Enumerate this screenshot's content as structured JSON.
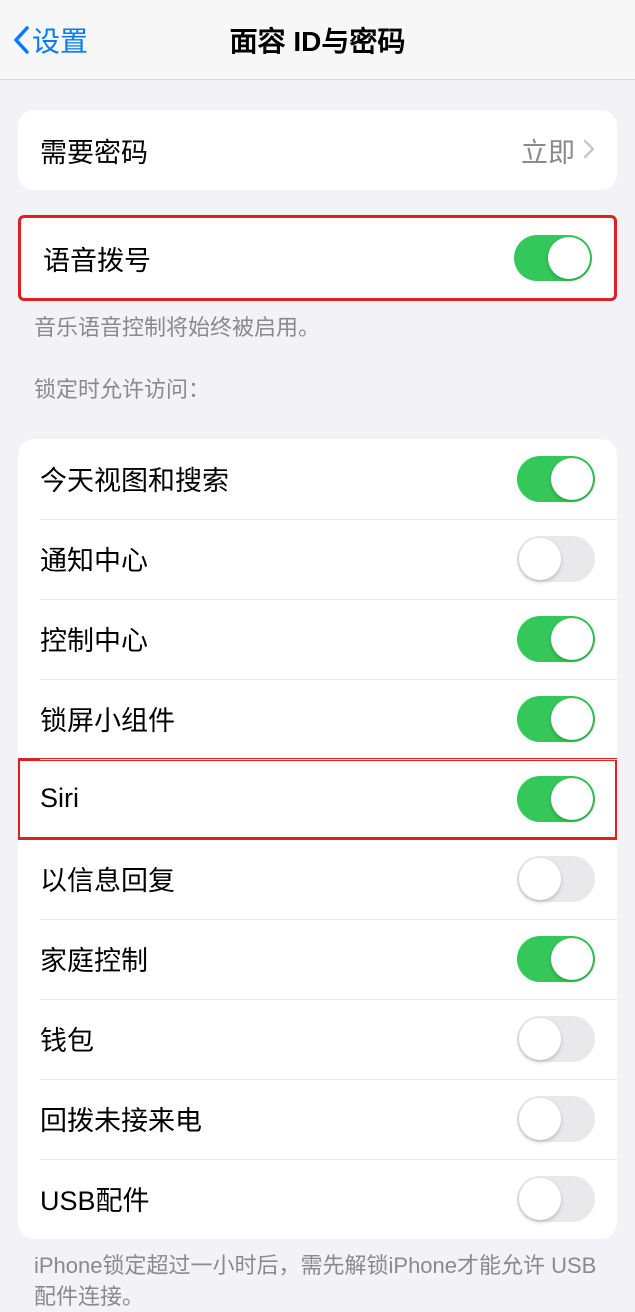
{
  "header": {
    "back_label": "设置",
    "title": "面容 ID与密码"
  },
  "passcode_row": {
    "label": "需要密码",
    "value": "立即"
  },
  "voice_dial": {
    "label": "语音拨号",
    "on": true,
    "footer": "音乐语音控制将始终被启用。"
  },
  "lock_section": {
    "header": "锁定时允许访问：",
    "items": [
      {
        "label": "今天视图和搜索",
        "on": true,
        "highlighted": false
      },
      {
        "label": "通知中心",
        "on": false,
        "highlighted": false
      },
      {
        "label": "控制中心",
        "on": true,
        "highlighted": false
      },
      {
        "label": "锁屏小组件",
        "on": true,
        "highlighted": false
      },
      {
        "label": "Siri",
        "on": true,
        "highlighted": true
      },
      {
        "label": "以信息回复",
        "on": false,
        "highlighted": false
      },
      {
        "label": "家庭控制",
        "on": true,
        "highlighted": false
      },
      {
        "label": "钱包",
        "on": false,
        "highlighted": false
      },
      {
        "label": "回拨未接来电",
        "on": false,
        "highlighted": false
      },
      {
        "label": "USB配件",
        "on": false,
        "highlighted": false
      }
    ],
    "footer": "iPhone锁定超过一小时后，需先解锁iPhone才能允许 USB 配件连接。"
  }
}
